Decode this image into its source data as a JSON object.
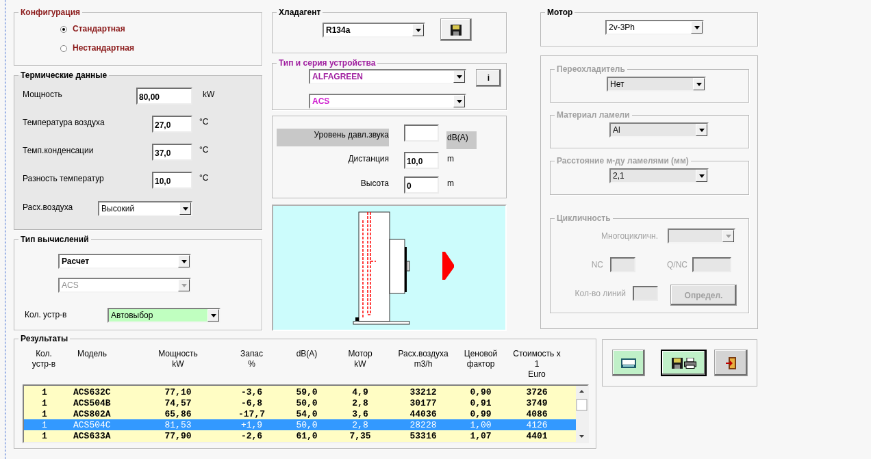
{
  "configuration": {
    "title": "Конфигурация",
    "options": [
      {
        "label": "Стандартная",
        "selected": true
      },
      {
        "label": "Нестандартная",
        "selected": false
      }
    ]
  },
  "thermal": {
    "title": "Термические данные",
    "fields": [
      {
        "label": "Мощность",
        "value": "80,00",
        "unit": "kW"
      },
      {
        "label": "Температура воздуха",
        "value": "27,0",
        "unit": "°C"
      },
      {
        "label": "Темп.конденсации",
        "value": "37,0",
        "unit": "°C"
      },
      {
        "label": "Разность температур",
        "value": "10,0",
        "unit": "°C"
      }
    ],
    "airflow": {
      "label": "Расх.воздуха",
      "value": "Высокий"
    }
  },
  "calculation": {
    "title": "Тип вычислений",
    "dropdowns": [
      {
        "value": "Расчет",
        "disabled": false
      },
      {
        "value": "ACS",
        "disabled": true
      }
    ],
    "units": {
      "label": "Кол. устр-в",
      "value": "Автовыбор"
    }
  },
  "refrigerant": {
    "title": "Хладагент",
    "value": "R134a"
  },
  "device": {
    "title": "Тип и серия устройства",
    "type": "ALFAGREEN",
    "series": "ACS",
    "info_button": "i"
  },
  "sound": [
    {
      "label": "Уровень давл.звука",
      "unit": "dB(A)",
      "highlighted": true
    },
    {
      "label": "Дистанция",
      "value": "10,0",
      "unit": "m",
      "highlighted": false
    },
    {
      "label": "Высота",
      "value": "0",
      "unit": "m",
      "highlighted": false
    }
  ],
  "motor": {
    "title": "Мотор",
    "value": "2v-3Ph"
  },
  "options_panel": {
    "disabled": true,
    "groups": [
      {
        "title": "Переохладитель",
        "value": "Нет"
      },
      {
        "title": "Материал ламели",
        "value": "Al"
      },
      {
        "title": "Расстояние м-ду ламелями (мм)",
        "value": "2,1"
      }
    ],
    "circuits": {
      "title": "Цикличность",
      "multi_label": "Многоцикличн.",
      "nc_label": "NC",
      "qnc_label": "Q/NC",
      "lines_label": "Кол-во линий",
      "button": "Определ."
    }
  },
  "results": {
    "title": "Результаты",
    "columns": [
      "Кол.\nустр-в",
      "Модель",
      "Мощность\nkW",
      "Запас\n%",
      "dB(A)",
      "Мотор\nkW",
      "Расх.воздуха\nm3/h",
      "Ценовой\nфактор",
      "Стоимость x\n1\nEuro"
    ],
    "rows": [
      {
        "cells": [
          "1",
          "ACS632C",
          "77,10",
          "-3,6",
          "59,0",
          "4,9",
          "33212",
          "0,90",
          "3726"
        ],
        "selected": false
      },
      {
        "cells": [
          "1",
          "ACS504B",
          "74,57",
          "-6,8",
          "50,0",
          "2,8",
          "30177",
          "0,91",
          "3749"
        ],
        "selected": false
      },
      {
        "cells": [
          "1",
          "ACS802A",
          "65,86",
          "-17,7",
          "54,0",
          "3,6",
          "44036",
          "0,99",
          "4086"
        ],
        "selected": false
      },
      {
        "cells": [
          "1",
          "ACS504C",
          "81,53",
          "+1,9",
          "50,0",
          "2,8",
          "28228",
          "1,00",
          "4126"
        ],
        "selected": true
      },
      {
        "cells": [
          "1",
          "ACS633A",
          "77,90",
          "-2,6",
          "61,0",
          "7,35",
          "53316",
          "1,07",
          "4401"
        ],
        "selected": false
      }
    ]
  },
  "actions": [
    {
      "kind": "calculate",
      "focused": false
    },
    {
      "kind": "save-print",
      "focused": true
    },
    {
      "kind": "exit",
      "focused": false
    }
  ]
}
